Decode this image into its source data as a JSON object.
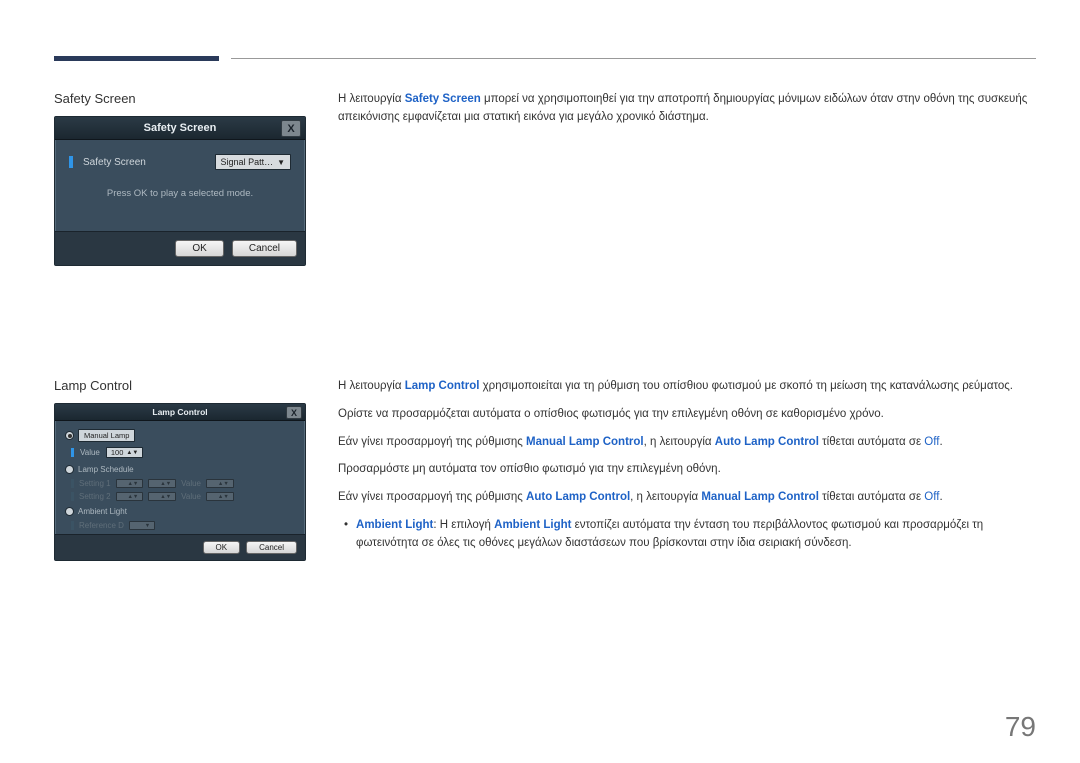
{
  "page_number": "79",
  "sections": {
    "safety": {
      "title": "Safety Screen",
      "desc_prefix": "Η λειτουργία ",
      "desc_term": "Safety Screen",
      "desc_suffix": " μπορεί να χρησιμοποιηθεί για την αποτροπή δημιουργίας μόνιμων ειδώλων όταν στην οθόνη της συσκευής απεικόνισης εμφανίζεται μια στατική εικόνα για μεγάλο χρονικό διάστημα."
    },
    "lamp": {
      "title": "Lamp Control",
      "p1_prefix": "Η λειτουργία ",
      "p1_term": "Lamp Control",
      "p1_suffix": " χρησιμοποιείται για τη ρύθμιση του οπίσθιου φωτισμού με σκοπό τη μείωση της κατανάλωσης ρεύματος.",
      "p2": "Ορίστε να προσαρμόζεται αυτόματα ο οπίσθιος φωτισμός για την επιλεγμένη οθόνη σε καθορισμένο χρόνο.",
      "p3_prefix": "Εάν γίνει προσαρμογή της ρύθμισης ",
      "p3_term1": "Manual Lamp Control",
      "p3_mid": ", η λειτουργία ",
      "p3_term2": "Auto Lamp Control",
      "p3_suffix": " τίθεται αυτόματα σε ",
      "p3_off": "Off",
      "p3_end": ".",
      "p4": "Προσαρμόστε μη αυτόματα τον οπίσθιο φωτισμό για την επιλεγμένη οθόνη.",
      "p5_prefix": "Εάν γίνει προσαρμογή της ρύθμισης ",
      "p5_term1": "Auto Lamp Control",
      "p5_mid": ", η λειτουργία ",
      "p5_term2": "Manual Lamp Control",
      "p5_suffix": " τίθεται αυτόματα σε ",
      "p5_off": "Off",
      "p5_end": ".",
      "bullet_term1": "Ambient Light",
      "bullet_mid1": ": Η επιλογή ",
      "bullet_term2": "Ambient Light",
      "bullet_suffix": " εντοπίζει αυτόματα την ένταση του περιβάλλοντος φωτισμού και προσαρμόζει τη φωτεινότητα σε όλες τις οθόνες μεγάλων διαστάσεων που βρίσκονται στην ίδια σειριακή σύνδεση."
    }
  },
  "dialog_safety": {
    "title": "Safety Screen",
    "close": "X",
    "label": "Safety Screen",
    "combo": "Signal Patt…",
    "hint": "Press OK to play a selected mode.",
    "ok": "OK",
    "cancel": "Cancel"
  },
  "dialog_lamp": {
    "title": "Lamp Control",
    "close": "X",
    "radio_manual": "Manual Lamp",
    "value_lbl": "Value",
    "value_num": "100",
    "schedule_lbl": "Lamp Schedule",
    "setting1": "Setting 1",
    "setting2": "Setting 2",
    "val_lbl": "Value",
    "ambient_lbl": "Ambient Light",
    "reference": "Reference D",
    "ok": "OK",
    "cancel": "Cancel"
  }
}
